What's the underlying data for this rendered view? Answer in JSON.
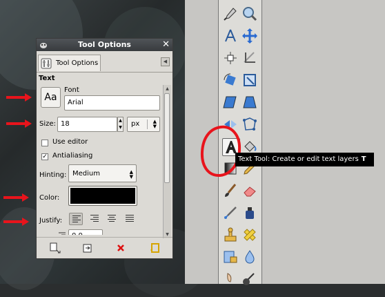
{
  "dialog": {
    "title": "Tool Options",
    "close_glyph": "✕",
    "tab_label": "Tool Options",
    "tab_menu_glyph": "◀",
    "section_title": "Text"
  },
  "font": {
    "button_label": "Aa",
    "label": "Font",
    "value": "Arial"
  },
  "size": {
    "label": "Size:",
    "value": "18",
    "unit": "px"
  },
  "options": {
    "use_editor": {
      "label": "Use editor",
      "checked": false
    },
    "antialiasing": {
      "label": "Antialiasing",
      "checked": true
    }
  },
  "hinting": {
    "label": "Hinting:",
    "value": "Medium"
  },
  "color": {
    "label": "Color:",
    "value": "#000000"
  },
  "justify": {
    "label": "Justify:",
    "modes": [
      "left",
      "right",
      "center",
      "fill"
    ],
    "selected": "left"
  },
  "indent": {
    "value": "0.0"
  },
  "bottom_bar": [
    "save-options-icon",
    "restore-options-icon",
    "delete-options-icon",
    "reset-options-icon"
  ],
  "tooltip": {
    "text": "Text Tool: Create or edit text layers",
    "accelerator": "T"
  },
  "toolbox": {
    "tools": [
      "color-picker-icon",
      "magnify-icon",
      "measure-icon",
      "move-icon",
      "align-icon",
      "crop-icon",
      "rotate-icon",
      "scale-icon",
      "shear-icon",
      "perspective-icon",
      "flip-icon",
      "cage-transform-icon",
      "text-tool-icon",
      "bucket-fill-icon",
      "blend-icon",
      "pencil-icon",
      "paintbrush-icon",
      "eraser-icon",
      "airbrush-icon",
      "ink-icon",
      "clone-icon",
      "heal-icon",
      "perspective-clone-icon",
      "blur-icon",
      "smudge-icon",
      "dodge-burn-icon"
    ],
    "active_tool": "text-tool-icon"
  },
  "accent_colors": {
    "annotation_red": "#e8141c",
    "tooltip_bg": "#000000"
  }
}
